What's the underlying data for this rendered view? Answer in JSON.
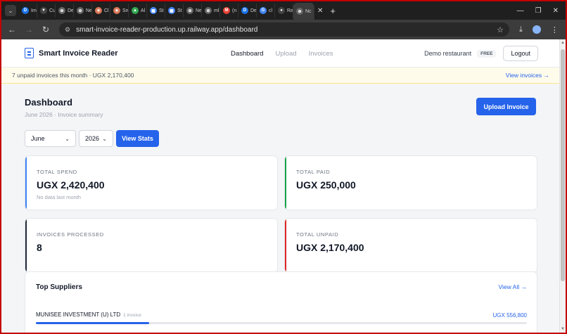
{
  "browser": {
    "url": "smart-invoice-reader-production.up.railway.app/dashboard",
    "tabs": [
      {
        "icon": "D",
        "label": "Im",
        "color": "#1a73e8"
      },
      {
        "icon": "▼",
        "label": "Cu",
        "color": "#444"
      },
      {
        "icon": "⊕",
        "label": "De",
        "color": "#666"
      },
      {
        "icon": "⊕",
        "label": "Ne",
        "color": "#666"
      },
      {
        "icon": "✷",
        "label": "Cl",
        "color": "#d97757"
      },
      {
        "icon": "✷",
        "label": "Sn",
        "color": "#d97757"
      },
      {
        "icon": "▲",
        "label": "Al",
        "color": "#34a853"
      },
      {
        "icon": "▦",
        "label": "St",
        "color": "#4285f4"
      },
      {
        "icon": "▦",
        "label": "St",
        "color": "#4285f4"
      },
      {
        "icon": "⊕",
        "label": "Ne",
        "color": "#666"
      },
      {
        "icon": "⊕",
        "label": "ml",
        "color": "#666"
      },
      {
        "icon": "M",
        "label": "(n",
        "color": "#ea4335"
      },
      {
        "icon": "D",
        "label": "De",
        "color": "#1a73e8"
      },
      {
        "icon": "G",
        "label": "cl",
        "color": "#4285f4"
      },
      {
        "icon": "●",
        "label": "Ra",
        "color": "#444"
      },
      {
        "icon": "⊕",
        "label": "Nc",
        "color": "#666"
      }
    ]
  },
  "app": {
    "brand": "Smart Invoice Reader",
    "nav": [
      "Dashboard",
      "Upload",
      "Invoices"
    ],
    "account_name": "Demo restaurant",
    "plan": "FREE",
    "logout": "Logout"
  },
  "banner": {
    "message": "7 unpaid invoices this month · UGX 2,170,400",
    "link": "View invoices →"
  },
  "dashboard": {
    "title": "Dashboard",
    "subtitle": "June 2026 · Invoice summary",
    "upload_button": "Upload Invoice",
    "month": "June",
    "year": "2026",
    "stats_button": "View Stats"
  },
  "cards": [
    {
      "label": "TOTAL SPEND",
      "value": "UGX 2,420,400",
      "note": "No data last month",
      "color": "#3b82f6"
    },
    {
      "label": "TOTAL PAID",
      "value": "UGX 250,000",
      "note": "",
      "color": "#16a34a"
    },
    {
      "label": "INVOICES PROCESSED",
      "value": "8",
      "note": "",
      "color": "#1f2937"
    },
    {
      "label": "TOTAL UNPAID",
      "value": "UGX 2,170,400",
      "note": "",
      "color": "#dc2626"
    }
  ],
  "suppliers": {
    "title": "Top Suppliers",
    "view_all": "View All →",
    "rows": [
      {
        "name": "MUNISEE INVESTMENT (U) LTD",
        "count": "1 invoice",
        "amount": "UGX 556,800",
        "share": 0.23
      }
    ]
  }
}
